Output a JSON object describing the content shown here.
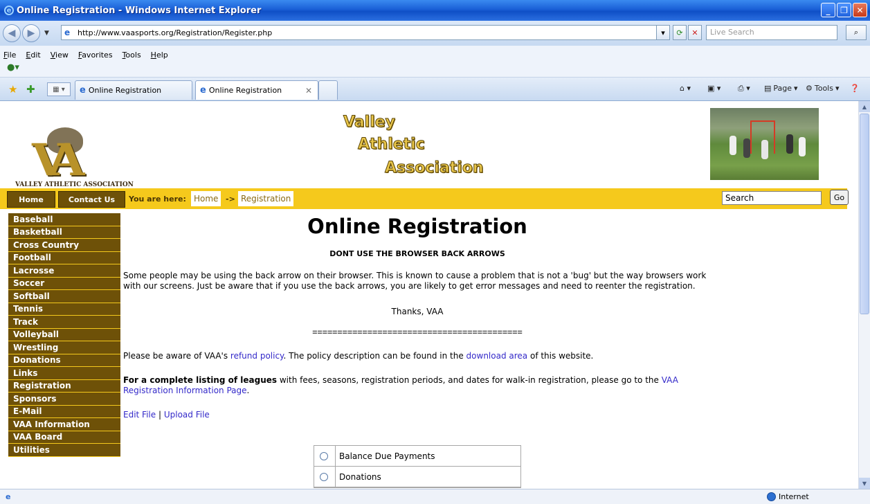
{
  "window": {
    "title": "Online Registration - Windows Internet Explorer",
    "url": "http://www.vaasports.org/Registration/Register.php",
    "live_search_placeholder": "Live Search",
    "menus": [
      "File",
      "Edit",
      "View",
      "Favorites",
      "Tools",
      "Help"
    ],
    "tabs": [
      "Online Registration",
      "Online Registration"
    ],
    "commands": {
      "page": "Page",
      "tools": "Tools"
    },
    "status_zone": "Internet"
  },
  "site": {
    "logo_text": "VALLEY ATHLETIC ASSOCIATION",
    "logo_letters": "VA",
    "brand_lines": [
      "Valley",
      "Athletic",
      "Association"
    ],
    "nav": {
      "home": "Home",
      "contact": "Contact Us",
      "you_are_here": "You are here:",
      "crumb_home": "Home",
      "crumb_arrow": "->",
      "crumb_current": "Registration",
      "search_value": "Search",
      "go": "Go"
    },
    "side_menu": [
      "Baseball",
      "Basketball",
      "Cross Country",
      "Football",
      "Lacrosse",
      "Soccer",
      "Softball",
      "Tennis",
      "Track",
      "Volleyball",
      "Wrestling",
      "Donations",
      "Links",
      "Registration",
      "Sponsors",
      "E-Mail",
      "VAA Information",
      "VAA Board",
      "Utilities"
    ]
  },
  "content": {
    "title": "Online Registration",
    "warning": "DONT USE THE BROWSER BACK ARROWS",
    "back_arrow_text": "Some people may be using the back arrow on their browser. This is known to cause a problem that is not a 'bug' but the way browsers work with our screens. Just be aware that if you use the back arrows, you are likely to get error messages and need to reenter the registration.",
    "thanks": "Thanks, VAA",
    "divider": "==========================================",
    "refund_pre": "Please be aware of VAA's ",
    "refund_link": "refund policy",
    "refund_mid": ". The policy description can be found in the ",
    "download_link": "download area",
    "refund_post": " of this website.",
    "leagues_bold": "For a complete listing of leagues",
    "leagues_text": " with fees, seasons, registration periods, and dates for walk-in registration, please go to the ",
    "leagues_link": "VAA Registration Information Page",
    "leagues_end": ".",
    "edit_file": "Edit File",
    "separator": "|",
    "upload_file": "Upload File",
    "options": [
      "Balance Due Payments",
      "Donations"
    ]
  },
  "colors": {
    "nav_gold": "#f5c91c",
    "menu_brown": "#6e5108",
    "link_blue": "#3329c9",
    "brand_gold": "#e9c64a"
  }
}
